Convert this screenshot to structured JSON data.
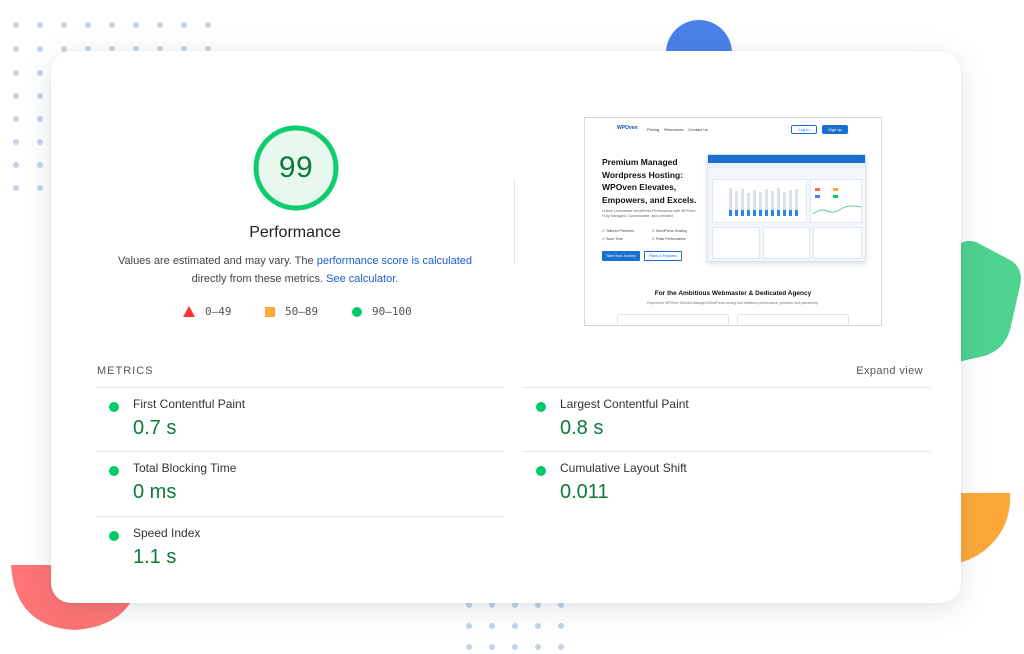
{
  "score": {
    "value": "99",
    "fraction": 0.99,
    "color": "#0cce6b"
  },
  "performance": {
    "title": "Performance",
    "desc_part1": "Values are estimated and may vary. The ",
    "desc_link1": "performance score is calculated",
    "desc_part2": " directly from these metrics. ",
    "desc_link2": "See calculator."
  },
  "legend": [
    {
      "range": "0–49",
      "color": "#ff3333"
    },
    {
      "range": "50–89",
      "color": "#ffaa33"
    },
    {
      "range": "90–100",
      "color": "#00cc66"
    }
  ],
  "screenshot": {
    "logo": "WPOven",
    "nav": [
      "Pricing",
      "Resources",
      "Contact Us"
    ],
    "login": "Log In",
    "signup": "Sign up",
    "headline": "Premium Managed Wordpress Hosting: WPOven Elevates, Empowers, and Excels.",
    "subtext": "Unlock Unbeatable WordPress Performance with WPOven: Fully Managed, Customizable, and unrivaled",
    "features": [
      "Tailored Premium",
      "WordPress Hosting",
      "Save Time",
      "Peak Performance"
    ],
    "cta1": "Start Your Journey",
    "cta2": "Plans & Features",
    "section_title": "For the Ambitious Webmaster & Dedicated Agency",
    "section_sub": "Experience WPOven Tailored Managed WordPress hosting that redefines performance, precision and partnership."
  },
  "metrics": {
    "label": "METRICS",
    "expand": "Expand view",
    "items": [
      {
        "name": "First Contentful Paint",
        "value": "0.7 s"
      },
      {
        "name": "Largest Contentful Paint",
        "value": "0.8 s"
      },
      {
        "name": "Total Blocking Time",
        "value": "0 ms"
      },
      {
        "name": "Cumulative Layout Shift",
        "value": "0.011"
      },
      {
        "name": "Speed Index",
        "value": "1.1 s"
      }
    ]
  },
  "decor_colors": {
    "blue": "#4a80e8",
    "green": "#4dd38f",
    "orange": "#fda93a",
    "red": "#ff7474",
    "dots": "#c5d3e6"
  }
}
